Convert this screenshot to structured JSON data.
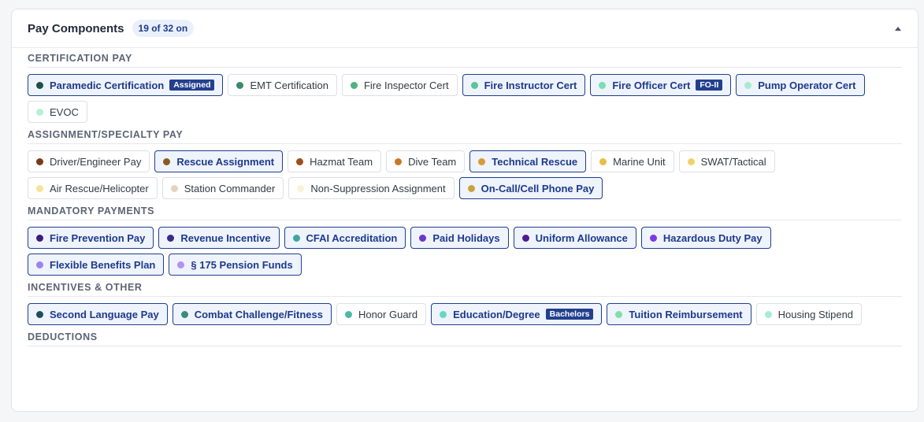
{
  "header": {
    "title": "Pay Components",
    "count_badge": "19 of 32 on"
  },
  "colors": {
    "selected_border": "#213e8f",
    "selected_bg": "#eef3fc",
    "selected_text": "#1e3a8a",
    "tag_bg": "#23408e"
  },
  "sections": [
    {
      "title": "CERTIFICATION PAY",
      "chips": [
        {
          "label": "Paramedic Certification",
          "on": true,
          "dot": "#1f4e4a",
          "tag": "Assigned"
        },
        {
          "label": "EMT Certification",
          "on": false,
          "dot": "#3d8a6a",
          "tag": ""
        },
        {
          "label": "Fire Inspector Cert",
          "on": false,
          "dot": "#4fb383",
          "tag": ""
        },
        {
          "label": "Fire Instructor Cert",
          "on": true,
          "dot": "#5cc496",
          "tag": ""
        },
        {
          "label": "Fire Officer Cert",
          "on": true,
          "dot": "#7cdcb4",
          "tag": "FO-II"
        },
        {
          "label": "Pump Operator Cert",
          "on": true,
          "dot": "#a6ecd0",
          "tag": ""
        },
        {
          "label": "EVOC",
          "on": false,
          "dot": "#b8f0d6",
          "tag": ""
        }
      ]
    },
    {
      "title": "ASSIGNMENT/SPECIALTY PAY",
      "chips": [
        {
          "label": "Driver/Engineer Pay",
          "on": false,
          "dot": "#7a3b1a",
          "tag": ""
        },
        {
          "label": "Rescue Assignment",
          "on": true,
          "dot": "#8a5a24",
          "tag": ""
        },
        {
          "label": "Hazmat Team",
          "on": false,
          "dot": "#9c4e1c",
          "tag": ""
        },
        {
          "label": "Dive Team",
          "on": false,
          "dot": "#c6782c",
          "tag": ""
        },
        {
          "label": "Technical Rescue",
          "on": true,
          "dot": "#d99a3a",
          "tag": ""
        },
        {
          "label": "Marine Unit",
          "on": false,
          "dot": "#e8be48",
          "tag": ""
        },
        {
          "label": "SWAT/Tactical",
          "on": false,
          "dot": "#f1d26a",
          "tag": ""
        },
        {
          "label": "Air Rescue/Helicopter",
          "on": false,
          "dot": "#f6e29a",
          "tag": ""
        },
        {
          "label": "Station Commander",
          "on": false,
          "dot": "#e3d4bf",
          "tag": ""
        },
        {
          "label": "Non-Suppression Assignment",
          "on": false,
          "dot": "#fbf1d4",
          "tag": ""
        },
        {
          "label": "On-Call/Cell Phone Pay",
          "on": true,
          "dot": "#c9a23e",
          "tag": ""
        }
      ]
    },
    {
      "title": "MANDATORY PAYMENTS",
      "chips": [
        {
          "label": "Fire Prevention Pay",
          "on": true,
          "dot": "#3a1f7a",
          "tag": ""
        },
        {
          "label": "Revenue Incentive",
          "on": true,
          "dot": "#3b2a8c",
          "tag": ""
        },
        {
          "label": "CFAI Accreditation",
          "on": true,
          "dot": "#3fa69e",
          "tag": ""
        },
        {
          "label": "Paid Holidays",
          "on": true,
          "dot": "#6c38c9",
          "tag": ""
        },
        {
          "label": "Uniform Allowance",
          "on": true,
          "dot": "#4b1f8c",
          "tag": ""
        },
        {
          "label": "Hazardous Duty Pay",
          "on": true,
          "dot": "#7a3ce0",
          "tag": ""
        },
        {
          "label": "Flexible Benefits Plan",
          "on": true,
          "dot": "#9d84ee",
          "tag": ""
        },
        {
          "label": "§ 175 Pension Funds",
          "on": true,
          "dot": "#b690f2",
          "tag": ""
        }
      ]
    },
    {
      "title": "INCENTIVES & OTHER",
      "chips": [
        {
          "label": "Second Language Pay",
          "on": true,
          "dot": "#1f4e5a",
          "tag": ""
        },
        {
          "label": "Combat Challenge/Fitness",
          "on": true,
          "dot": "#3c8a7a",
          "tag": ""
        },
        {
          "label": "Honor Guard",
          "on": false,
          "dot": "#4fb8a6",
          "tag": ""
        },
        {
          "label": "Education/Degree",
          "on": true,
          "dot": "#6ad6c2",
          "tag": "Bachelors"
        },
        {
          "label": "Tuition Reimbursement",
          "on": true,
          "dot": "#7ee0a8",
          "tag": ""
        },
        {
          "label": "Housing Stipend",
          "on": false,
          "dot": "#a6ecd8",
          "tag": ""
        }
      ]
    },
    {
      "title": "DEDUCTIONS",
      "chips": []
    }
  ]
}
